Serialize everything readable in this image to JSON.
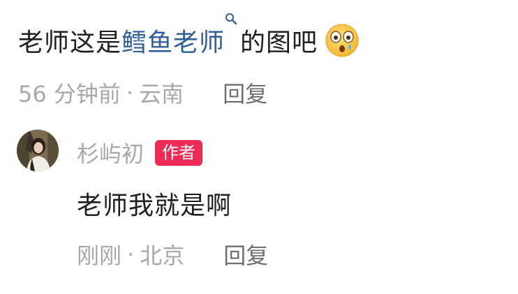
{
  "colors": {
    "link": "#2f5f9c",
    "meta": "#a8a8a8",
    "reply_action": "#6e6e6e",
    "text": "#1f1f1f",
    "author_badge_bg": "#ee2a55"
  },
  "comment": {
    "prefix": "老师这是",
    "mention": "鳕鱼老师",
    "mention_icon": "search-icon",
    "suffix": "的图吧",
    "emoji_icon": "dizzy-face-emoji-icon",
    "time": "56 分钟前",
    "separator": "·",
    "location": "云南",
    "reply_label": "回复"
  },
  "reply": {
    "avatar_icon": "user-avatar",
    "author_name": "杉屿初",
    "author_badge": "作者",
    "text": "老师我就是啊",
    "time": "刚刚",
    "separator": "·",
    "location": "北京",
    "reply_label": "回复"
  }
}
